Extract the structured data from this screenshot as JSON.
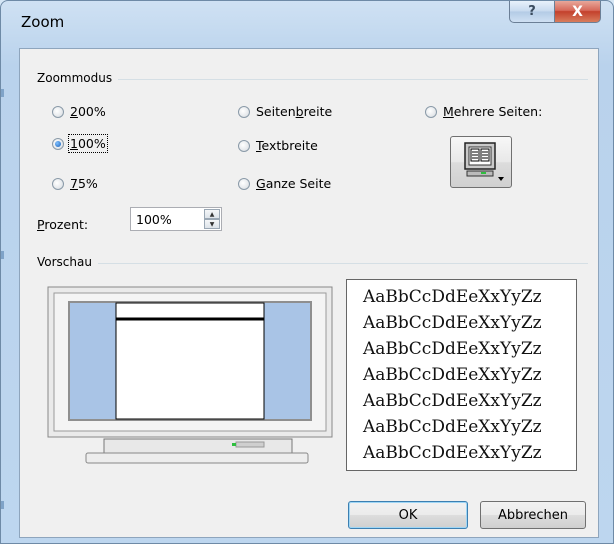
{
  "window": {
    "title": "Zoom",
    "help_glyph": "?",
    "close_glyph": "X"
  },
  "zoommodus": {
    "group_label": "Zoommodus",
    "options": {
      "p200": {
        "label": "200%",
        "selected": false
      },
      "p100": {
        "label": "100%",
        "selected": true
      },
      "p75": {
        "label": "75%",
        "selected": false
      },
      "seitenbreite": {
        "label": "Seitenbreite",
        "selected": false
      },
      "textbreite": {
        "label": "Textbreite",
        "selected": false
      },
      "ganze_seite": {
        "label": "Ganze Seite",
        "selected": false
      },
      "mehrere_seiten": {
        "label": "Mehrere Seiten:",
        "selected": false
      }
    },
    "prozent_label": "Prozent:",
    "prozent_value": "100%"
  },
  "vorschau": {
    "group_label": "Vorschau",
    "sample_lines": [
      "AaBbCcDdEeXxYyZz",
      "AaBbCcDdEeXxYyZz",
      "AaBbCcDdEeXxYyZz",
      "AaBbCcDdEeXxYyZz",
      "AaBbCcDdEeXxYyZz",
      "AaBbCcDdEeXxYyZz",
      "AaBbCcDdEeXxYyZz"
    ]
  },
  "buttons": {
    "ok": "OK",
    "cancel": "Abbrechen"
  },
  "colors": {
    "accent": "#3c7fb1",
    "close_red": "#c3402c",
    "preview_side": "#a9c4e6"
  },
  "icons": {
    "multi_page": "monitor-pages-icon"
  }
}
